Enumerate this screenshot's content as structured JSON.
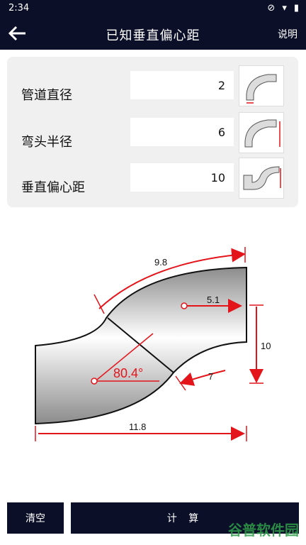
{
  "status_bar": {
    "time": "2:34"
  },
  "header": {
    "title": "已知垂直偏心距",
    "help_label": "说明"
  },
  "inputs": [
    {
      "label": "管道直径",
      "value": "2"
    },
    {
      "label": "弯头半径",
      "value": "6"
    },
    {
      "label": "垂直偏心距",
      "value": "10"
    }
  ],
  "diagram": {
    "top_length": "9.8",
    "offset_dim": "5.1",
    "vertical_offset": "10",
    "angle": "80.4°",
    "lower_length": "7",
    "bottom_length": "11.8",
    "accent_color": "#e4141b"
  },
  "footer": {
    "clear_label": "清空",
    "calc_label": "计 算"
  },
  "watermark": "谷普软件园"
}
